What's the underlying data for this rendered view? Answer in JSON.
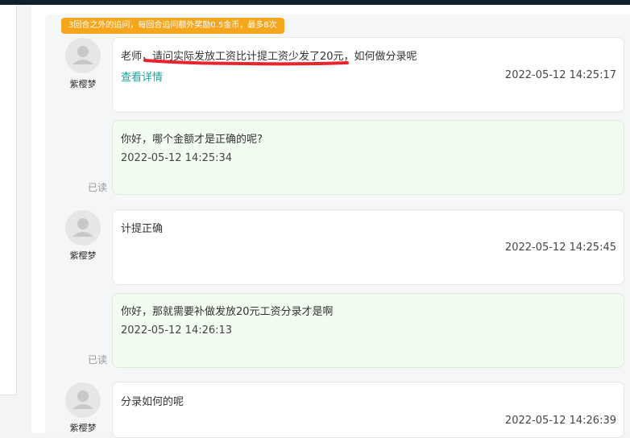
{
  "banner": {
    "text": "3回合之外的追问，每回合追问额外奖励0.5金币，最多8次"
  },
  "messages": [
    {
      "role": "asker",
      "user": "紫樱梦",
      "text": "老师，请问实际发放工资比计提工资少发了20元，如何做分录呢",
      "link": "查看详情",
      "time": "2022-05-12 14:25:17"
    },
    {
      "role": "teacher",
      "text": "你好，哪个金额才是正确的呢?",
      "time": "2022-05-12 14:25:34",
      "status": "已读"
    },
    {
      "role": "asker",
      "user": "紫樱梦",
      "text": "计提正确",
      "time": "2022-05-12 14:25:45"
    },
    {
      "role": "teacher",
      "text": "你好，那就需要补做发放20元工资分录才是啊",
      "time": "2022-05-12 14:26:13",
      "status": "已读"
    },
    {
      "role": "asker",
      "user": "紫樱梦",
      "text": "分录如何的呢",
      "time": "2022-05-12 14:26:39"
    }
  ],
  "colors": {
    "banner": "#f6a61d",
    "link": "#1aa39a",
    "reply_bubble": "#f2fcf0",
    "underline": "#e8242c"
  }
}
